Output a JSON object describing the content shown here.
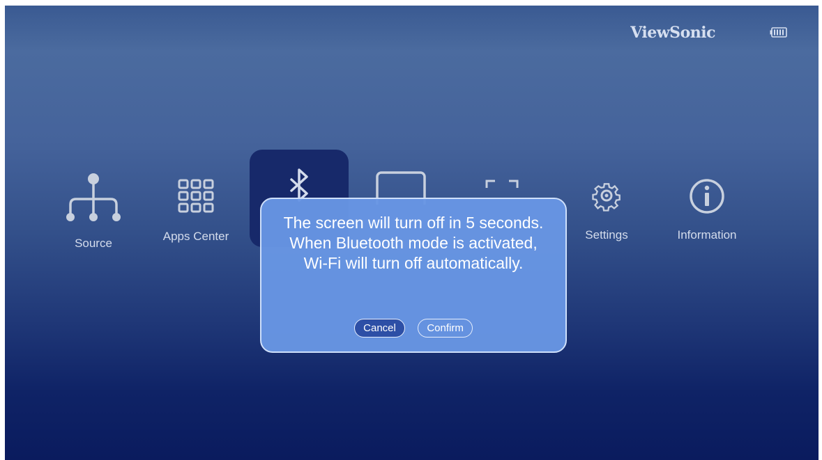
{
  "header": {
    "brand": "ViewSonic",
    "battery_icon": "battery-icon"
  },
  "menu": {
    "items": [
      {
        "label": "Source",
        "icon": "source-tree-icon"
      },
      {
        "label": "Apps Center",
        "icon": "apps-grid-icon"
      },
      {
        "label": "",
        "icon": "bluetooth-icon",
        "selected": true
      },
      {
        "label": "",
        "icon": "screen-icon"
      },
      {
        "label": "",
        "icon": "screen-mirror-icon"
      },
      {
        "label": "Settings",
        "icon": "gear-icon"
      },
      {
        "label": "Information",
        "icon": "info-icon"
      }
    ]
  },
  "dialog": {
    "message": "The screen will turn off in 5 seconds. When Bluetooth mode is activated, Wi-Fi will turn off automatically.",
    "cancel_label": "Cancel",
    "confirm_label": "Confirm"
  },
  "colors": {
    "highlight": "#17296a",
    "dialog_bg": "#6896e4",
    "cancel_bg": "#2d4fa6",
    "icon": "#c8d0de"
  }
}
